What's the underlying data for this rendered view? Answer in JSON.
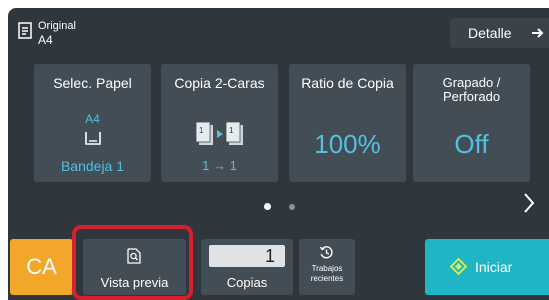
{
  "original": {
    "icon": "original-document-icon",
    "label": "Original",
    "value": "A4"
  },
  "detail_button": {
    "label": "Detalle",
    "icon": "arrow-right-icon"
  },
  "cards": [
    {
      "title": "Selec. Papel",
      "paper_size": "A4",
      "tray_icon": "paper-tray-icon",
      "tray": "Bandeja 1"
    },
    {
      "title": "Copia 2-Caras",
      "icon": "duplex-copy-icon",
      "value": "1 → 1"
    },
    {
      "title": "Ratio de Copia",
      "value": "100%"
    },
    {
      "title": "Grapado / Perforado",
      "value": "Off"
    }
  ],
  "pagination": {
    "pages": 2,
    "current": 1
  },
  "next_icon": "chevron-right-icon",
  "bottom": {
    "ca_label": "CA",
    "preview": {
      "label": "Vista previa",
      "icon": "preview-search-icon"
    },
    "copies": {
      "value": "1",
      "label": "Copias"
    },
    "recent": {
      "label": "Trabajos recientes",
      "icon": "recent-jobs-icon"
    },
    "start": {
      "label": "Iniciar",
      "icon": "start-diamond-icon"
    }
  },
  "colors": {
    "panel": "#2f373d",
    "card": "#434d55",
    "value_text": "#52c0e0",
    "ca_button": "#f2a62a",
    "start_button": "#1fb5c4",
    "highlight": "#d6202e"
  }
}
